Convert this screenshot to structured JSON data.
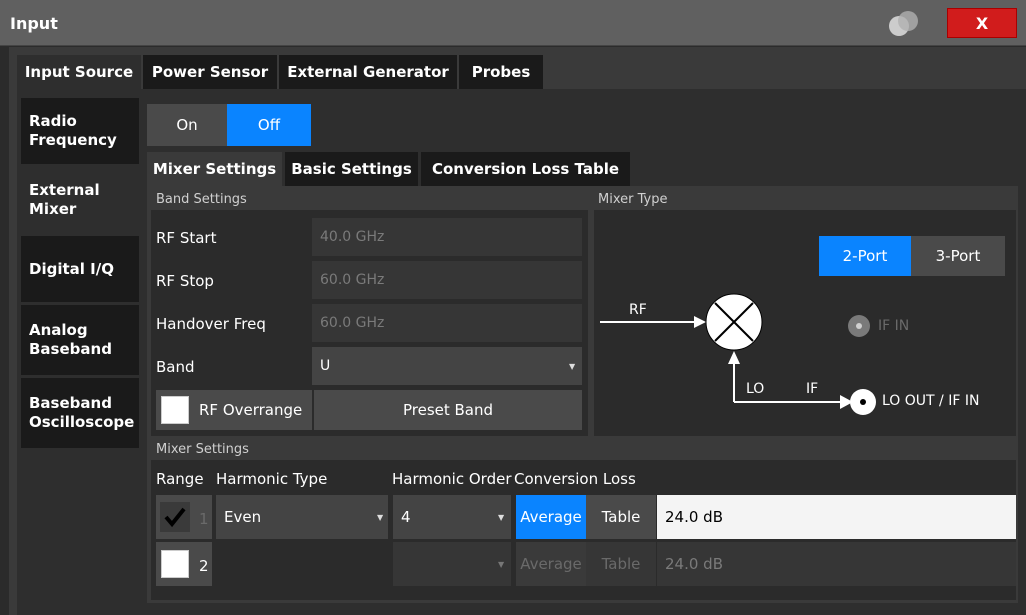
{
  "window": {
    "title": "Input",
    "close_label": "X"
  },
  "top_tabs": [
    "Input Source",
    "Power Sensor",
    "External Generator",
    "Probes"
  ],
  "side_tabs": [
    [
      "Radio",
      "Frequency"
    ],
    [
      "External",
      "Mixer"
    ],
    [
      "Digital I/Q"
    ],
    [
      "Analog",
      "Baseband"
    ],
    [
      "Baseband",
      "Oscilloscope"
    ]
  ],
  "state_toggle": {
    "on_label": "On",
    "off_label": "Off",
    "selected": "Off"
  },
  "sub_tabs": [
    "Mixer Settings",
    "Basic Settings",
    "Conversion Loss Table"
  ],
  "band_settings": {
    "title": "Band Settings",
    "rf_start_label": "RF Start",
    "rf_start_value": "40.0 GHz",
    "rf_stop_label": "RF Stop",
    "rf_stop_value": "60.0 GHz",
    "handover_label": "Handover Freq",
    "handover_value": "60.0 GHz",
    "band_label": "Band",
    "band_value": "U",
    "overrange_label": "RF Overrange",
    "overrange_checked": false,
    "preset_label": "Preset Band"
  },
  "mixer_type": {
    "title": "Mixer Type",
    "port2_label": "2-Port",
    "port3_label": "3-Port",
    "selected": "2-Port",
    "rf_label": "RF",
    "lo_label": "LO",
    "if_label": "IF",
    "if_in_label": "IF IN",
    "lo_out_label": "LO OUT / IF IN"
  },
  "mixer_settings": {
    "title": "Mixer Settings",
    "headers": {
      "range": "Range",
      "harmonic_type": "Harmonic Type",
      "harmonic_order": "Harmonic Order",
      "conversion_loss": "Conversion Loss"
    },
    "rows": [
      {
        "checked": true,
        "range": "1",
        "type": "Even",
        "order": "4",
        "average_label": "Average",
        "table_label": "Table",
        "mode": "Average",
        "loss": "24.0 dB",
        "enabled": true
      },
      {
        "checked": false,
        "range": "2",
        "type": "",
        "order": "",
        "average_label": "Average",
        "table_label": "Table",
        "mode": "Average",
        "loss": "24.0 dB",
        "enabled": false
      }
    ]
  },
  "colors": {
    "accent": "#0a84ff",
    "close": "#d11c1c"
  }
}
